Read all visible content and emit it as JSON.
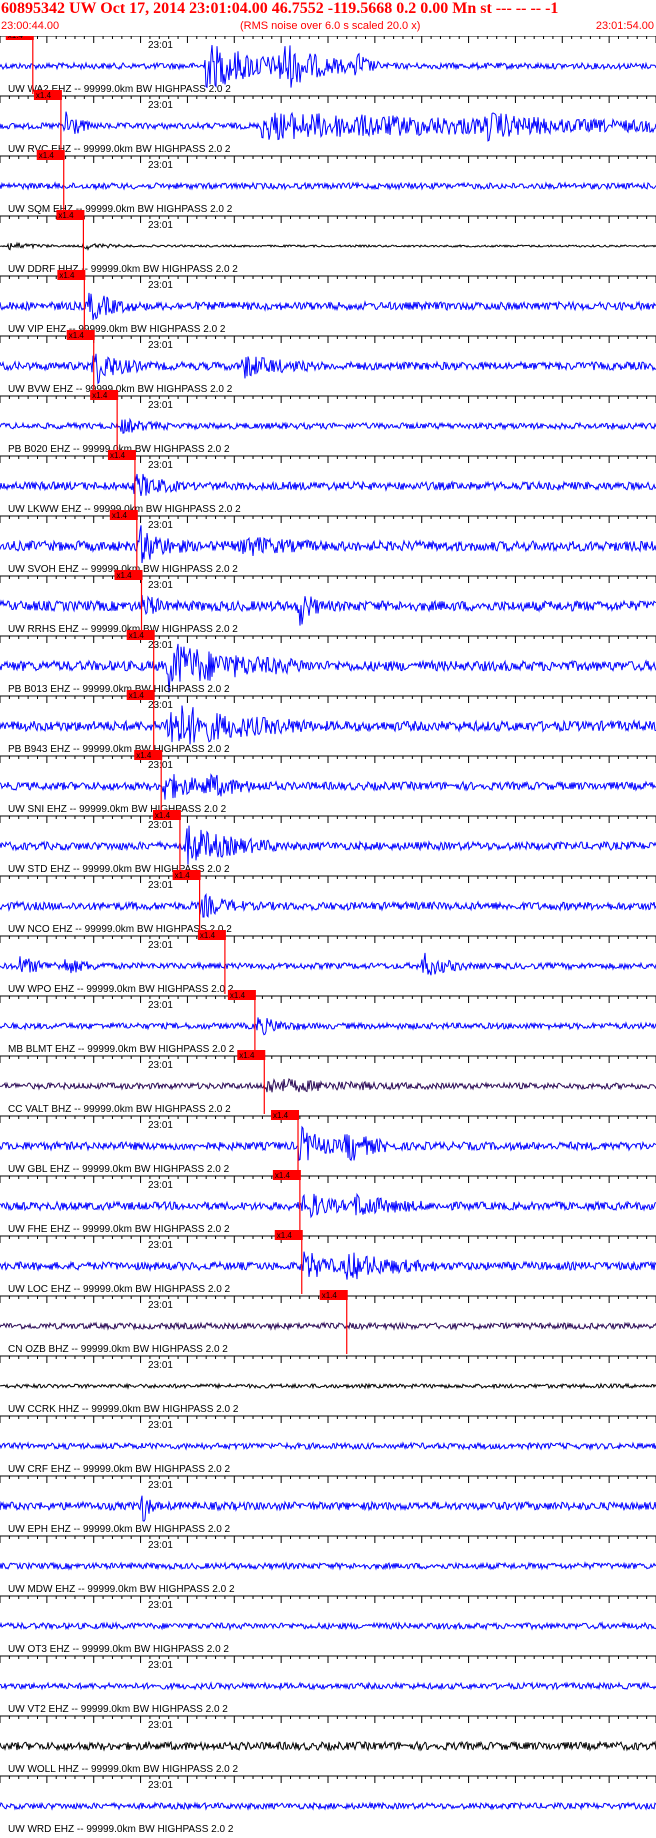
{
  "header": {
    "title": "60895342 UW Oct 17, 2014 23:01:04.00   46.7552 -119.5668  0.2 0.00 Mn st --- -- --  -1",
    "start_time": "23:00:44.00",
    "rms_note": "(RMS noise over 6.0 s scaled 20.0 x)",
    "end_time": "23:01:54.00"
  },
  "colors": {
    "trace_blue": "#0000ff",
    "trace_dark": "#000000",
    "trace_purple": "#2a0a55",
    "pick_red": "#ff0000",
    "text_black": "#000000",
    "axis": "#000000"
  },
  "chart_data": {
    "type": "line",
    "title": "60895342 UW Oct 17, 2014 23:01:04.00",
    "x_axis_start": "23:00:44.00",
    "x_axis_end": "23:01:54.00",
    "minute_label": "23:01",
    "pick_label": "x1.4",
    "traces": [
      {
        "label": "UW WA2 EHZ -- 99999.0km BW  HIGHPASS  2.0  2",
        "pick_s": 3.5,
        "amp": 3,
        "color": "blue",
        "bursts": [
          [
            22,
            6,
            22
          ],
          [
            30,
            3,
            20
          ],
          [
            38,
            1,
            16
          ]
        ]
      },
      {
        "label": "UW RVC EHZ -- 99999.0km BW  HIGHPASS  2.0  2",
        "pick_s": 6.5,
        "amp": 3,
        "color": "blue",
        "bursts": [
          [
            7,
            1,
            20
          ],
          [
            28,
            30,
            12
          ],
          [
            52,
            3,
            8
          ]
        ]
      },
      {
        "label": "UW SQM EHZ -- 99999.0km BW  HIGHPASS  2.0  2",
        "pick_s": 6.8,
        "amp": 3,
        "color": "blue",
        "bursts": []
      },
      {
        "label": "UW DDRF HHZ -- 99999.0km BW  HIGHPASS  2.0  2",
        "pick_s": 8.9,
        "amp": 1,
        "color": "dark",
        "bursts": [
          [
            1,
            2,
            4
          ],
          [
            9,
            2,
            3
          ]
        ]
      },
      {
        "label": "UW VIP EHZ -- 99999.0km BW  HIGHPASS  2.0  2",
        "pick_s": 9.0,
        "amp": 4,
        "color": "blue",
        "bursts": [
          [
            9.5,
            2,
            14
          ]
        ]
      },
      {
        "label": "UW BVW EHZ -- 99999.0km BW  HIGHPASS  2.0  2",
        "pick_s": 10.0,
        "amp": 4,
        "color": "blue",
        "bursts": [
          [
            10,
            2,
            18
          ],
          [
            26,
            3,
            10
          ]
        ]
      },
      {
        "label": "PB B020 EHZ -- 99999.0km BW  HIGHPASS  2.0  2",
        "pick_s": 12.5,
        "amp": 3,
        "color": "blue",
        "bursts": [
          [
            13,
            2,
            6
          ]
        ]
      },
      {
        "label": "UW LKWW EHZ -- 99999.0km BW  HIGHPASS  2.0  2",
        "pick_s": 14.4,
        "amp": 4,
        "color": "blue",
        "bursts": [
          [
            14.5,
            2,
            12
          ]
        ]
      },
      {
        "label": "UW SVOH EHZ -- 99999.0km BW  HIGHPASS  2.0  2",
        "pick_s": 14.6,
        "amp": 5,
        "color": "blue",
        "bursts": [
          [
            15,
            2,
            16
          ],
          [
            26,
            3,
            8
          ]
        ]
      },
      {
        "label": "UW RRHS EHZ -- 99999.0km BW  HIGHPASS  2.0  2",
        "pick_s": 15.1,
        "amp": 5,
        "color": "blue",
        "bursts": [
          [
            15.3,
            1,
            12
          ],
          [
            32,
            1,
            18
          ]
        ]
      },
      {
        "label": "PB B013 EHZ -- 99999.0km BW  HIGHPASS  2.0  2",
        "pick_s": 16.4,
        "amp": 5,
        "color": "blue",
        "bursts": [
          [
            18,
            6,
            22
          ]
        ]
      },
      {
        "label": "PB B943 EHZ -- 99999.0km BW  HIGHPASS  2.0  2",
        "pick_s": 16.4,
        "amp": 5,
        "color": "blue",
        "bursts": [
          [
            18,
            6,
            22
          ]
        ]
      },
      {
        "label": "UW SNI EHZ -- 99999.0km BW  HIGHPASS  2.0  2",
        "pick_s": 17.2,
        "amp": 4,
        "color": "blue",
        "bursts": [
          [
            17.5,
            3,
            12
          ],
          [
            22,
            3,
            8
          ]
        ]
      },
      {
        "label": "UW STD EHZ -- 99999.0km BW  HIGHPASS  2.0  2",
        "pick_s": 19.2,
        "amp": 4,
        "color": "blue",
        "bursts": [
          [
            20,
            4,
            18
          ]
        ]
      },
      {
        "label": "UW NCO EHZ -- 99999.0km BW  HIGHPASS  2.0  2",
        "pick_s": 21.3,
        "amp": 4,
        "color": "blue",
        "bursts": [
          [
            21.5,
            2,
            10
          ]
        ]
      },
      {
        "label": "UW WPO EHZ -- 99999.0km BW  HIGHPASS  2.0  2",
        "pick_s": 24.0,
        "amp": 3,
        "color": "blue",
        "bursts": [
          [
            2,
            2,
            8
          ],
          [
            7,
            2,
            6
          ],
          [
            45,
            2,
            12
          ]
        ]
      },
      {
        "label": "MB BLMT EHZ -- 99999.0km BW  HIGHPASS  2.0  2",
        "pick_s": 27.2,
        "amp": 3,
        "color": "blue",
        "bursts": [
          [
            27.5,
            2,
            8
          ]
        ]
      },
      {
        "label": "CC VALT BHZ -- 99999.0km BW  HIGHPASS  2.0  2",
        "pick_s": 28.2,
        "amp": 3,
        "color": "purple",
        "bursts": [
          [
            28.5,
            6,
            6
          ]
        ]
      },
      {
        "label": "UW GBL EHZ -- 99999.0km BW  HIGHPASS  2.0  2",
        "pick_s": 31.8,
        "amp": 4,
        "color": "blue",
        "bursts": [
          [
            32,
            2,
            18
          ],
          [
            37,
            2,
            16
          ]
        ]
      },
      {
        "label": "UW FHE EHZ -- 99999.0km BW  HIGHPASS  2.0  2",
        "pick_s": 32.0,
        "amp": 4,
        "color": "blue",
        "bursts": [
          [
            32.5,
            2,
            14
          ],
          [
            38,
            3,
            10
          ]
        ]
      },
      {
        "label": "UW LOC EHZ -- 99999.0km BW  HIGHPASS  2.0  2",
        "pick_s": 32.2,
        "amp": 4,
        "color": "blue",
        "bursts": [
          [
            32.5,
            2,
            14
          ],
          [
            37,
            4,
            12
          ]
        ]
      },
      {
        "label": "CN OZB BHZ -- 99999.0km BW  HIGHPASS  2.0  2",
        "pick_s": 37.0,
        "amp": 3,
        "color": "purple",
        "bursts": []
      },
      {
        "label": "UW CCRK HHZ -- 99999.0km BW  HIGHPASS  2.0  2",
        "pick_s": null,
        "amp": 2,
        "color": "dark",
        "bursts": []
      },
      {
        "label": "UW CRF EHZ -- 99999.0km BW  HIGHPASS  2.0  2",
        "pick_s": null,
        "amp": 3,
        "color": "blue",
        "bursts": []
      },
      {
        "label": "UW EPH EHZ -- 99999.0km BW  HIGHPASS  2.0  2",
        "pick_s": null,
        "amp": 4,
        "color": "blue",
        "bursts": [
          [
            15.3,
            0.5,
            18
          ]
        ]
      },
      {
        "label": "UW MDW EHZ -- 99999.0km BW  HIGHPASS  2.0  2",
        "pick_s": null,
        "amp": 3,
        "color": "blue",
        "bursts": []
      },
      {
        "label": "UW OT3 EHZ -- 99999.0km BW  HIGHPASS  2.0  2",
        "pick_s": null,
        "amp": 3,
        "color": "blue",
        "bursts": []
      },
      {
        "label": "UW VT2 EHZ -- 99999.0km BW  HIGHPASS  2.0  2",
        "pick_s": null,
        "amp": 3,
        "color": "blue",
        "bursts": []
      },
      {
        "label": "UW WOLL HHZ -- 99999.0km BW  HIGHPASS  2.0  2",
        "pick_s": null,
        "amp": 4,
        "color": "dark",
        "bursts": []
      },
      {
        "label": "UW WRD EHZ -- 99999.0km BW  HIGHPASS  2.0  2",
        "pick_s": null,
        "amp": 3,
        "color": "blue",
        "bursts": []
      }
    ]
  }
}
